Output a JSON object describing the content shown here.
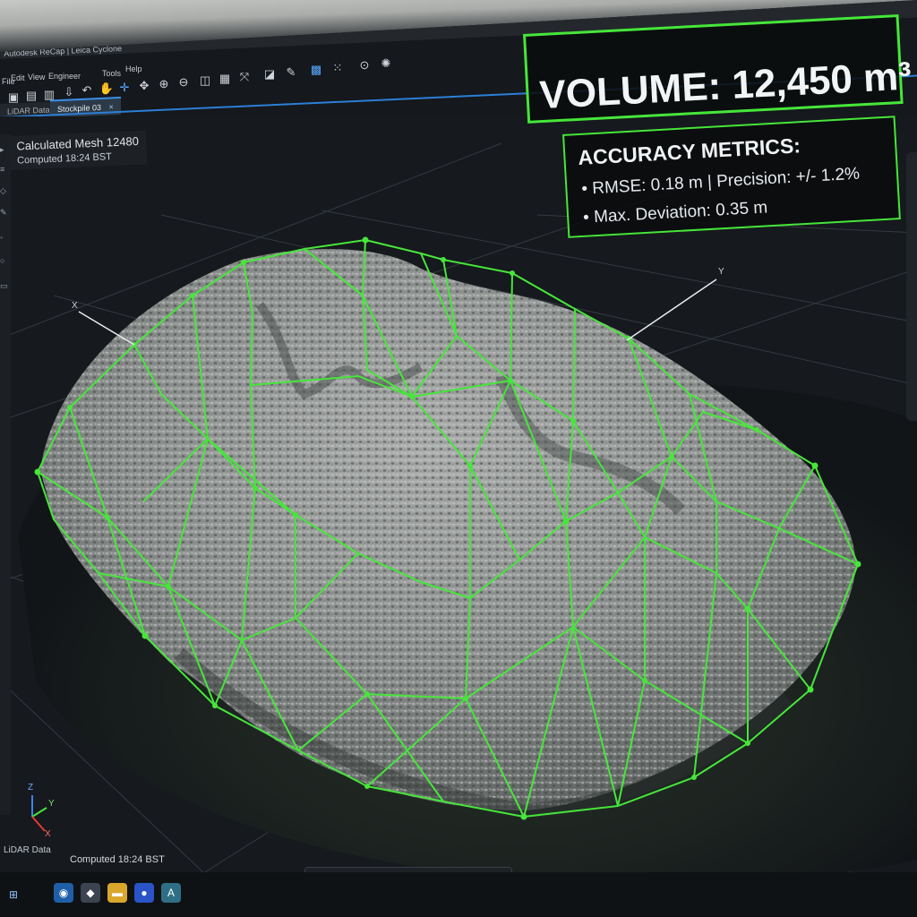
{
  "app": {
    "title": "Autodesk ReCap | Leica Cyclone"
  },
  "menu": {
    "items": [
      "File",
      "Edit",
      "View",
      "Engineer",
      "Tools",
      "Help"
    ]
  },
  "tabs": [
    {
      "label": "LiDAR Data"
    },
    {
      "label": "Stockpile 03",
      "close": "×"
    }
  ],
  "mesh_info": {
    "line1": "Calculated Mesh 12480",
    "line2": "Computed 18:24 BST"
  },
  "volume": {
    "text": "VOLUME: 12,450 m³"
  },
  "metrics": {
    "heading": "ACCURACY METRICS:",
    "items": [
      "• RMSE: 0.18 m | Precision: +/- 1.2%",
      "• Max. Deviation: 0.35 m"
    ]
  },
  "axes": {
    "x": "X",
    "y": "Y",
    "z": "Z"
  },
  "status": {
    "source": "LiDAR Data",
    "computed": "Computed 18:24 BST"
  },
  "colors": {
    "mesh_green": "#46e63a",
    "accent_blue": "#2b7fd6"
  }
}
